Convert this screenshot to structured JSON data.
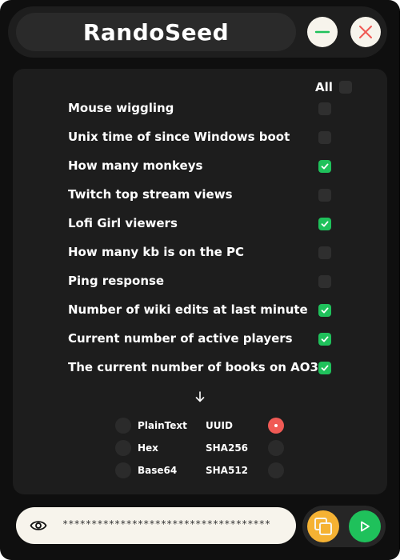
{
  "app": {
    "title": "RandoSeed"
  },
  "window_controls": {
    "minimize_icon": "minus-icon",
    "close_icon": "x-icon"
  },
  "sources": {
    "all_label": "All",
    "all_checked": false,
    "items": [
      {
        "label": "Mouse wiggling",
        "checked": false
      },
      {
        "label": "Unix time of since Windows boot",
        "checked": false
      },
      {
        "label": "How many monkeys",
        "checked": true
      },
      {
        "label": "Twitch top stream views",
        "checked": false
      },
      {
        "label": "Lofi Girl viewers",
        "checked": true
      },
      {
        "label": "How many kb is on the PC",
        "checked": false
      },
      {
        "label": "Ping response",
        "checked": false
      },
      {
        "label": "Number of wiki edits at last minute",
        "checked": true
      },
      {
        "label": "Current number of active players",
        "checked": true
      },
      {
        "label": "The current number of books on AO3",
        "checked": true
      }
    ]
  },
  "formats": {
    "left": [
      {
        "label": "PlainText",
        "selected": false
      },
      {
        "label": "Hex",
        "selected": false
      },
      {
        "label": "Base64",
        "selected": false
      }
    ],
    "right": [
      {
        "label": "UUID",
        "selected": true
      },
      {
        "label": "SHA256",
        "selected": false
      },
      {
        "label": "SHA512",
        "selected": false
      }
    ]
  },
  "output": {
    "value": "************************************",
    "visibility_icon": "eye-icon"
  },
  "actions": {
    "copy_icon": "copy-icon",
    "run_icon": "play-icon"
  },
  "colors": {
    "accent_green": "#1fc15b",
    "accent_red": "#f05a55",
    "accent_orange": "#f5b233",
    "background": "#0f0f0f",
    "panel": "#1d1d1d",
    "cream": "#f7f4ec"
  }
}
